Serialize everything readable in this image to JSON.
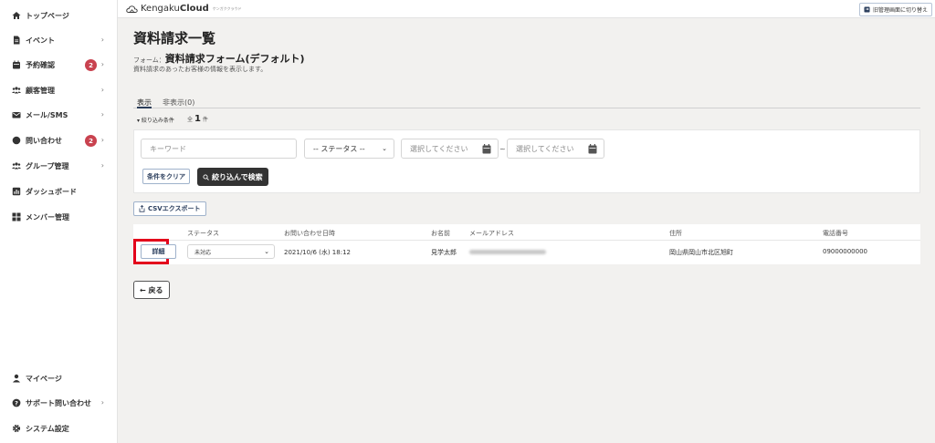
{
  "sidebar": {
    "items": [
      {
        "label": "トップページ",
        "icon": "home-icon",
        "chevron": ""
      },
      {
        "label": "イベント",
        "icon": "document-icon",
        "chevron": "›"
      },
      {
        "label": "予約確認",
        "icon": "calendar-icon",
        "chevron": "›",
        "badge": "2"
      },
      {
        "label": "顧客管理",
        "icon": "group-icon",
        "chevron": "›"
      },
      {
        "label": "メール/SMS",
        "icon": "mail-icon",
        "chevron": "›"
      },
      {
        "label": "問い合わせ",
        "icon": "chat-icon",
        "chevron": "›",
        "badge": "2"
      },
      {
        "label": "グループ管理",
        "icon": "group-icon",
        "chevron": "›"
      },
      {
        "label": "ダッシュボード",
        "icon": "chart-icon",
        "chevron": ""
      },
      {
        "label": "メンバー管理",
        "icon": "grid-icon",
        "chevron": ""
      }
    ],
    "bottom_items": [
      {
        "label": "マイページ",
        "icon": "user-icon",
        "chevron": ""
      },
      {
        "label": "サポート問い合わせ",
        "icon": "help-icon",
        "chevron": "›"
      },
      {
        "label": "システム設定",
        "icon": "gear-icon",
        "chevron": ""
      }
    ]
  },
  "header": {
    "brand_prefix": "Kengaku",
    "brand_bold": "Cloud",
    "brand_sub": "ケンガククラウド",
    "switch_label": "旧管理画面に切り替え"
  },
  "main": {
    "title": "資料請求一覧",
    "form_prefix": "フォーム：",
    "form_name": "資料請求フォーム(デフォルト)",
    "description": "資料請求のあったお客様の情報を表示します。",
    "tabs": [
      {
        "label": "表示",
        "active": true
      },
      {
        "label": "非表示(0)",
        "active": false
      }
    ],
    "filter_toggle": "▾ 絞り込み条件",
    "count_prefix": "全",
    "count_value": "1",
    "count_suffix": "件",
    "filters": {
      "keyword_placeholder": "キーワード",
      "status_value": "-- ステータス --",
      "date_from_placeholder": "選択してください",
      "date_separator": "~",
      "date_to_placeholder": "選択してください",
      "clear_label": "条件をクリア",
      "search_label": "絞り込んで検索"
    },
    "csv_label": "CSVエクスポート",
    "table": {
      "headers": [
        "ステータス",
        "お問い合わせ日時",
        "お名前",
        "メールアドレス",
        "住所",
        "電話番号"
      ],
      "rows": [
        {
          "detail_label": "詳細",
          "status": "未対応",
          "datetime": "2021/10/6 (水) 18:12",
          "name": "見学太郎",
          "address": "岡山県岡山市北区旭町",
          "phone": "09000000000"
        }
      ]
    },
    "back_label": "← 戻る"
  }
}
